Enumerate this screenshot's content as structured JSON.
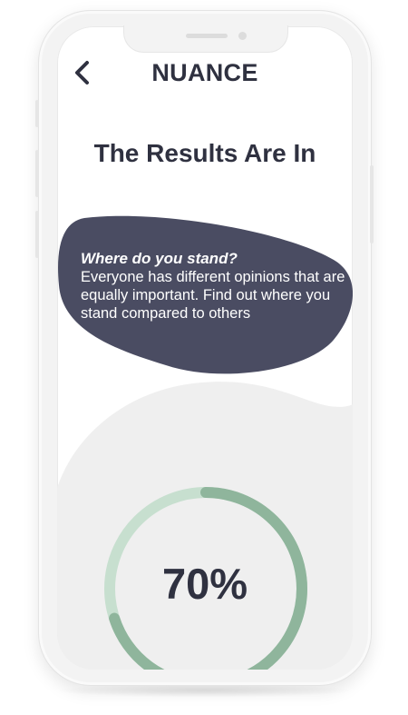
{
  "header": {
    "back_icon": "chevron-left-icon",
    "app_title": "NUANCE"
  },
  "page": {
    "title": "The Results Are In"
  },
  "info_card": {
    "heading": "Where do you stand?",
    "body": "Everyone has different opinions that are equally important. Find out where you stand compared to others"
  },
  "result": {
    "percent_label": "70%",
    "progress_fraction": 0.7
  },
  "colors": {
    "text_dark": "#2f3140",
    "card_bg": "#4a4c62",
    "ring_progress": "#8fb59c",
    "ring_track": "#c7dfcf",
    "wave_bg": "#efefef"
  }
}
